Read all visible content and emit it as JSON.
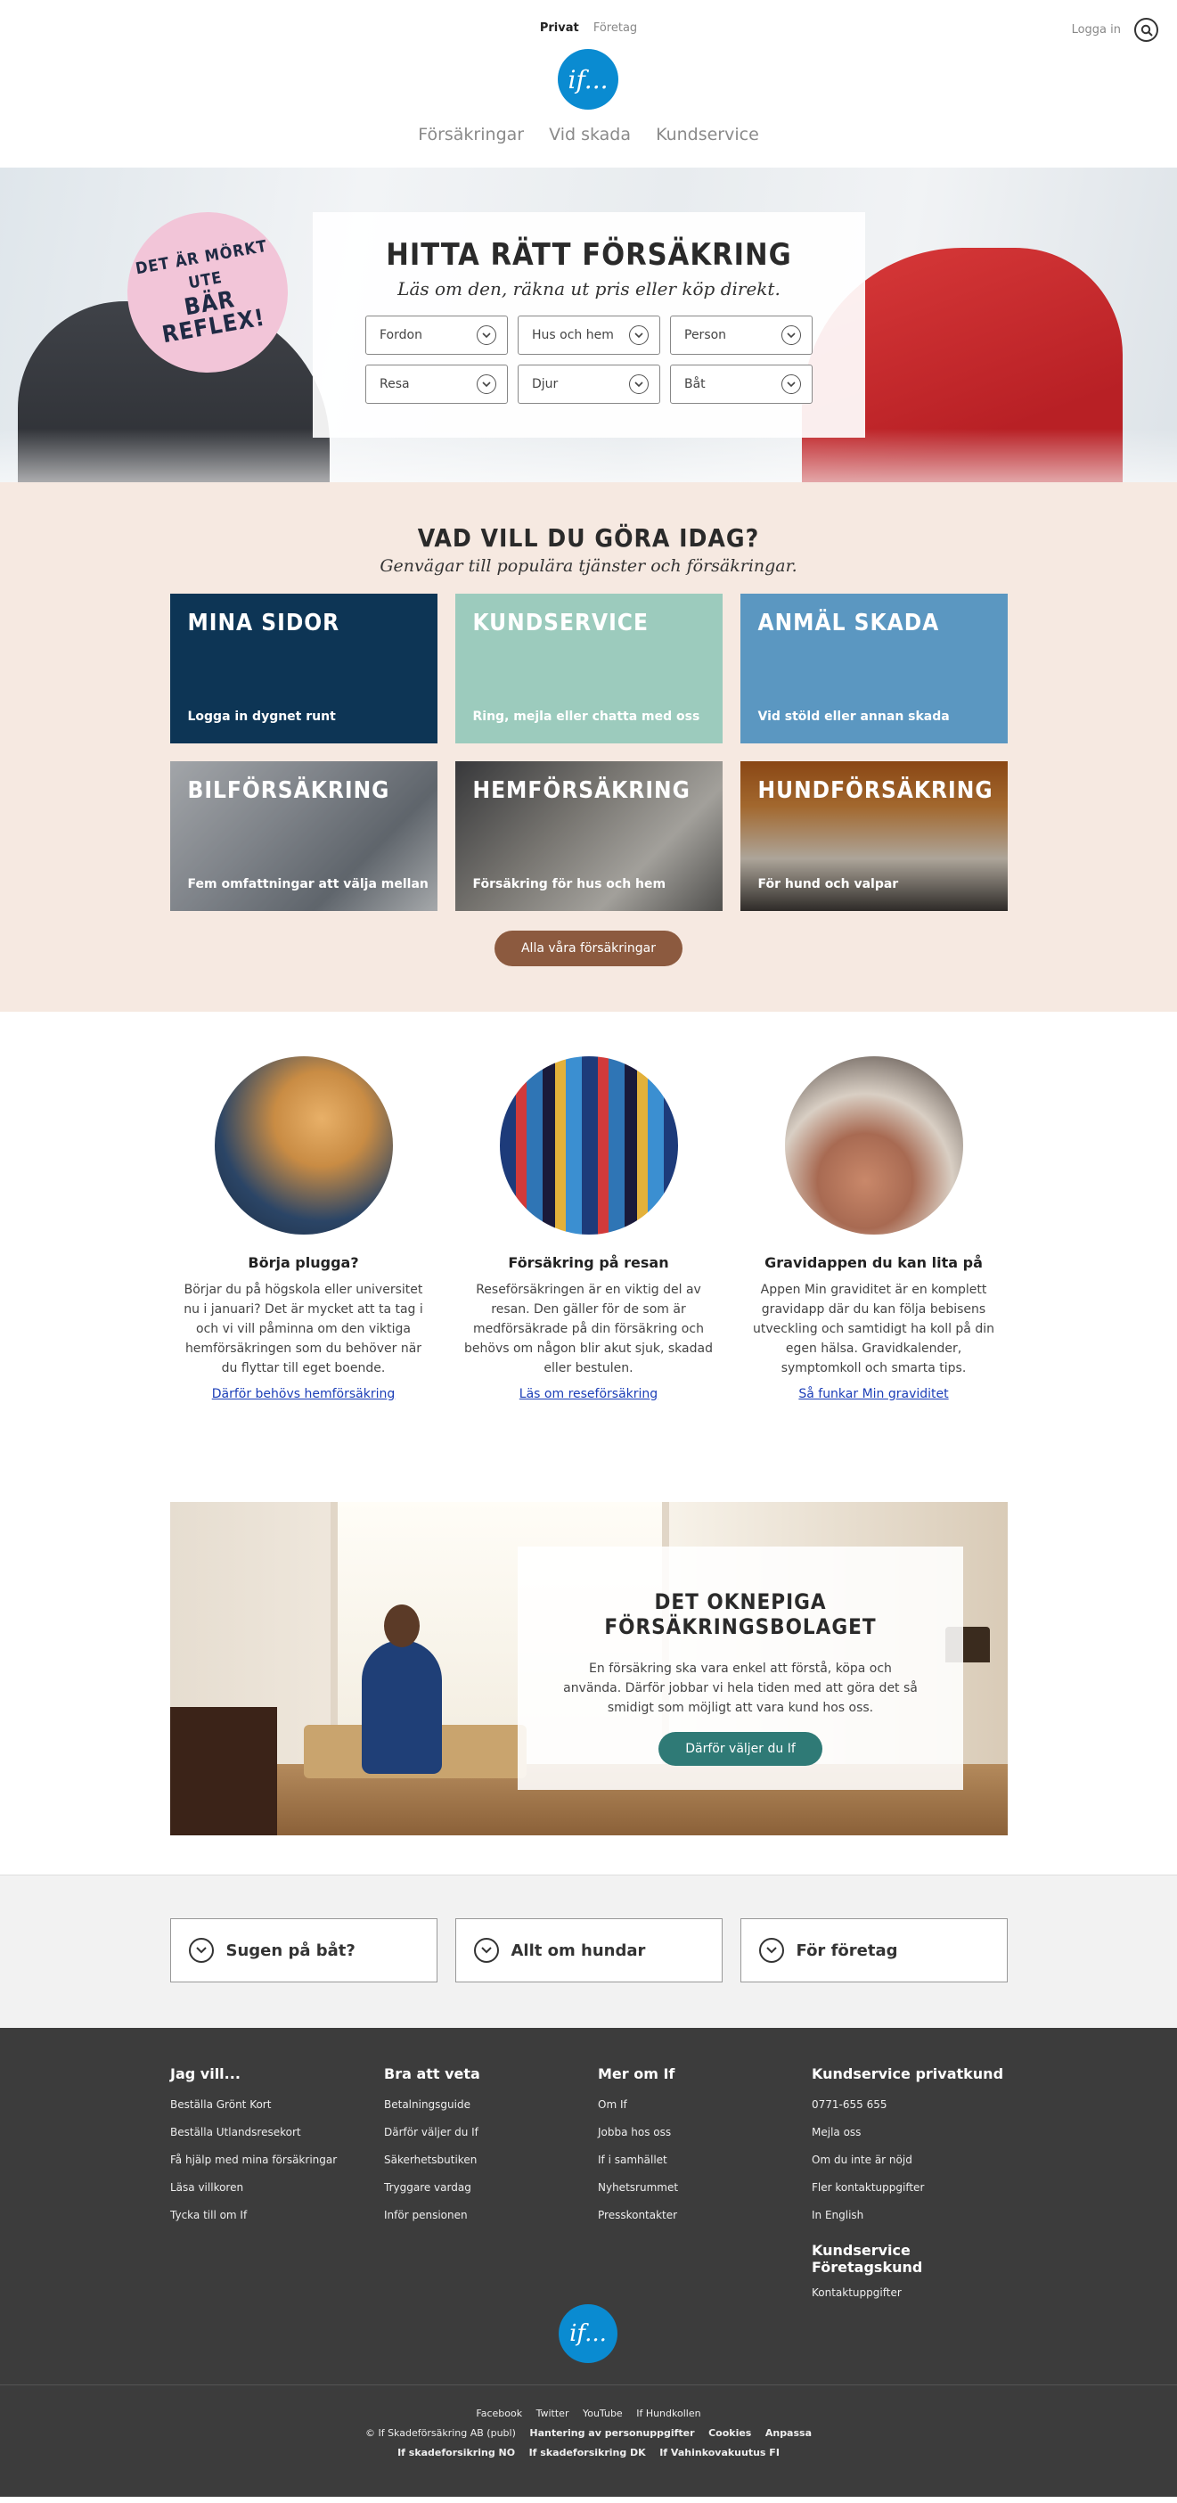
{
  "header": {
    "segments": {
      "private": "Privat",
      "business": "Företag"
    },
    "login": "Logga in",
    "logo_text": "if...",
    "nav": [
      "Försäkringar",
      "Vid skada",
      "Kundservice"
    ]
  },
  "hero": {
    "badge_line1": "Det är mörkt ute",
    "badge_line2": "Bär reflex!",
    "title": "Hitta rätt försäkring",
    "subtitle": "Läs om den, räkna ut pris eller köp direkt.",
    "selects": [
      "Fordon",
      "Hus och hem",
      "Person",
      "Resa",
      "Djur",
      "Båt"
    ]
  },
  "quick": {
    "title": "Vad vill du göra idag?",
    "subtitle": "Genvägar till populära tjänster och försäkringar.",
    "tiles": [
      {
        "title": "Mina sidor",
        "desc": "Logga in dygnet runt"
      },
      {
        "title": "Kundservice",
        "desc": "Ring, mejla eller chatta med oss"
      },
      {
        "title": "Anmäl skada",
        "desc": "Vid stöld eller annan skada"
      },
      {
        "title": "Bilförsäkring",
        "desc": "Fem omfattningar att välja mellan"
      },
      {
        "title": "Hemförsäkring",
        "desc": "Försäkring för hus och hem"
      },
      {
        "title": "Hundförsäkring",
        "desc": "För hund och valpar"
      }
    ],
    "all_button": "Alla våra försäkringar"
  },
  "features": [
    {
      "title": "Börja plugga?",
      "text": "Börjar du på högskola eller universitet nu i januari? Det är mycket att ta tag i och vi vill påminna om den viktiga hemförsäkringen som du behöver när du flyttar till eget boende.",
      "link": "Därför behövs hemförsäkring"
    },
    {
      "title": "Försäkring på resan",
      "text": "Reseförsäkringen är en viktig del av resan. Den gäller för de som är medförsäkrade på din försäkring och behövs om någon blir akut sjuk, skadad eller bestulen.",
      "link": "Läs om reseförsäkring"
    },
    {
      "title": "Gravidappen du kan lita på",
      "text": "Appen Min graviditet är en komplett gravidapp där du kan följa bebisens utveckling och samtidigt ha koll på din egen hälsa. Gravidkalender, symptomkoll och smarta tips.",
      "link": "Så funkar Min graviditet"
    }
  ],
  "banner": {
    "title": "Det oknepiga försäkringsbolaget",
    "text": "En försäkring ska vara enkel att förstå, köpa och använda. Därför jobbar vi hela tiden med att göra det så smidigt som möjligt att vara kund hos oss.",
    "button": "Därför väljer du If"
  },
  "accordions": [
    "Sugen på båt?",
    "Allt om hundar",
    "För företag"
  ],
  "footer": {
    "columns": [
      {
        "title": "Jag vill...",
        "items": [
          "Beställa Grönt Kort",
          "Beställa Utlandsresekort",
          "Få hjälp med mina försäkringar",
          "Läsa villkoren",
          "Tycka till om If"
        ]
      },
      {
        "title": "Bra att veta",
        "items": [
          "Betalningsguide",
          "Därför väljer du If",
          "Säkerhetsbutiken",
          "Tryggare vardag",
          "Inför pensionen"
        ]
      },
      {
        "title": "Mer om If",
        "items": [
          "Om If",
          "Jobba hos oss",
          "If i samhället",
          "Nyhetsrummet",
          "Presskontakter"
        ]
      },
      {
        "title": "Kundservice privatkund",
        "items": [
          "0771-655 655",
          "Mejla oss",
          "Om du inte är nöjd",
          "Fler kontaktuppgifter",
          "In English"
        ]
      }
    ],
    "business_title": "Kundservice Företagskund",
    "business_item": "Kontaktuppgifter",
    "social": [
      "Facebook",
      "Twitter",
      "YouTube",
      "If Hundkollen"
    ],
    "legal": [
      "© If Skadeförsäkring AB (publ)",
      "Hantering av personuppgifter",
      "Cookies",
      "Anpassa"
    ],
    "countries": [
      "If skadeforsikring NO",
      "If skadeforsikring DK",
      "If Vahinkovakuutus FI"
    ]
  }
}
